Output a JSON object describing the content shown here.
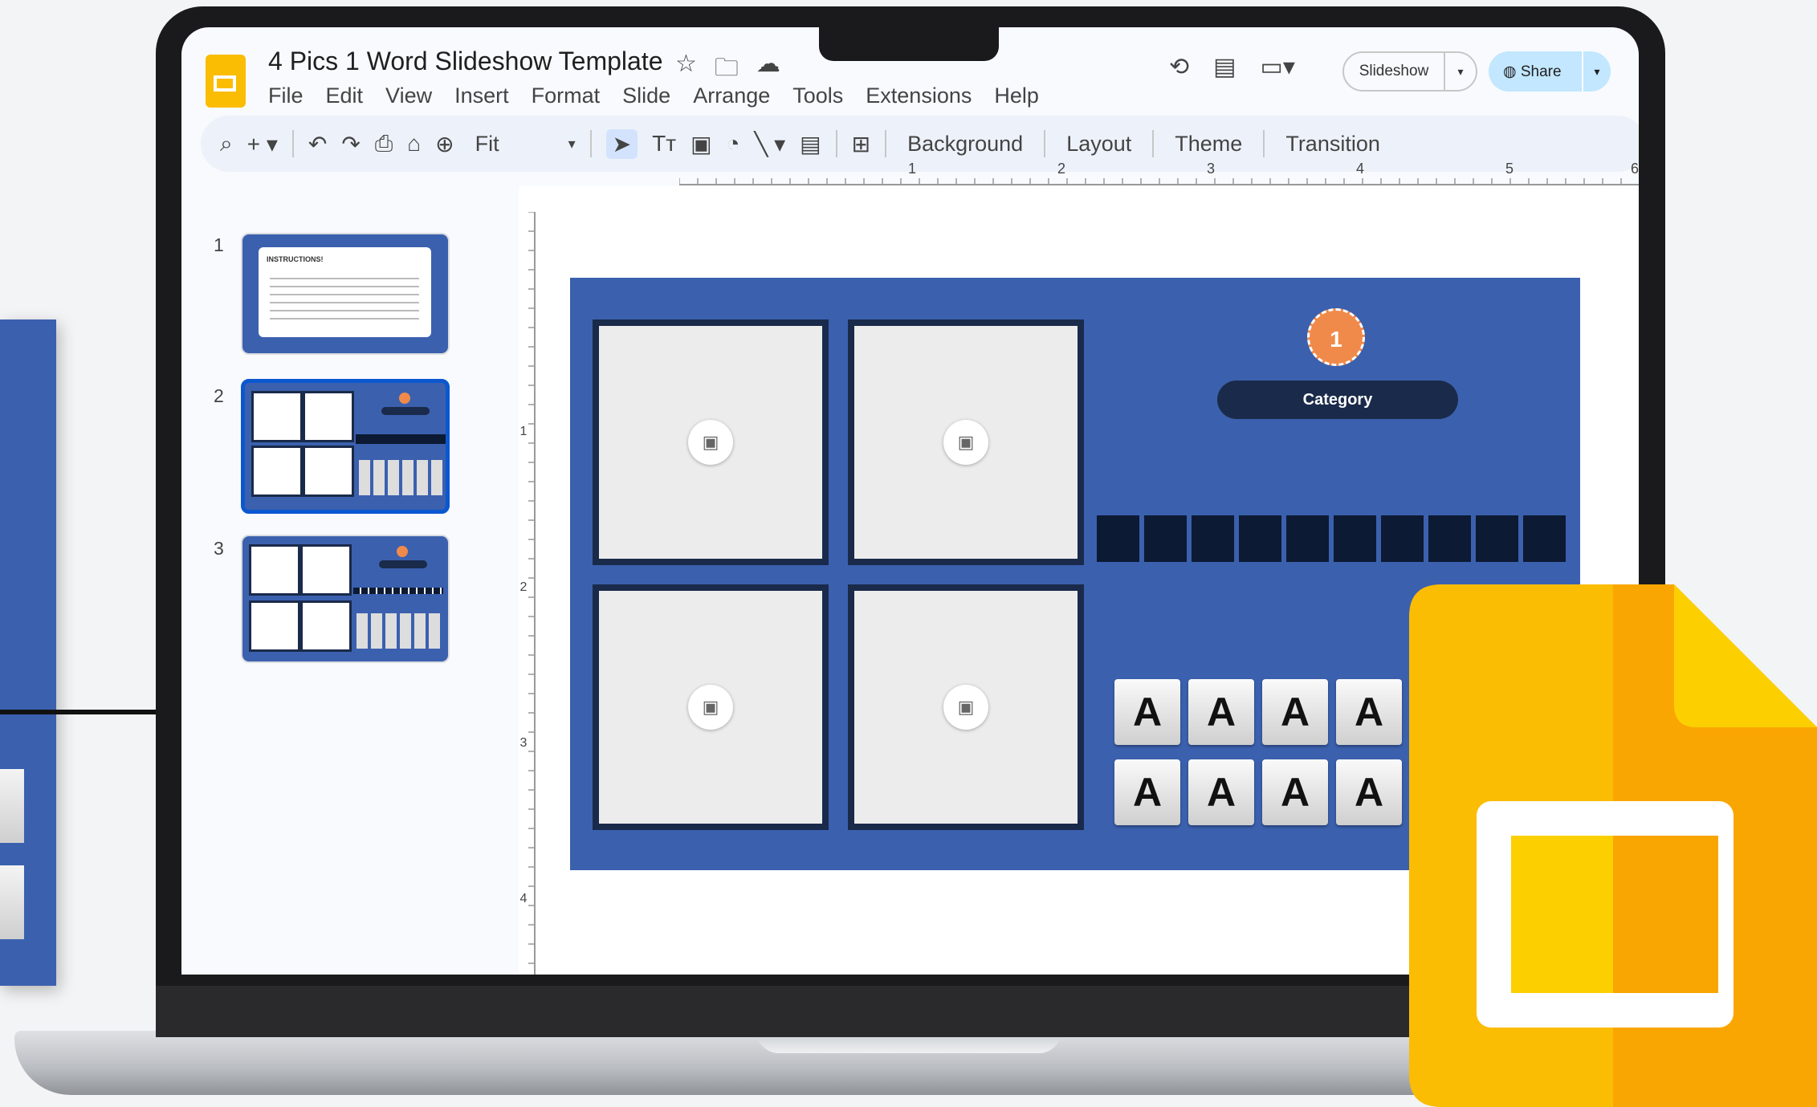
{
  "document": {
    "title": "4 Pics 1 Word Slideshow Template"
  },
  "menu": [
    "File",
    "Edit",
    "View",
    "Insert",
    "Format",
    "Slide",
    "Arrange",
    "Tools",
    "Extensions",
    "Help"
  ],
  "header_buttons": {
    "slideshow": "Slideshow",
    "share": "Share"
  },
  "toolbar": {
    "zoom": "Fit",
    "background": "Background",
    "layout": "Layout",
    "theme": "Theme",
    "transition": "Transition"
  },
  "ruler": {
    "top": [
      "1",
      "2",
      "3",
      "4",
      "5",
      "6"
    ],
    "left": [
      "1",
      "2",
      "3",
      "4"
    ]
  },
  "filmstrip": {
    "slides": [
      "1",
      "2",
      "3"
    ],
    "thumb1_heading": "INSTRUCTIONS!",
    "selected": "2"
  },
  "slide": {
    "badge_number": "1",
    "category_label": "Category",
    "letters_row1": [
      "A",
      "A",
      "A",
      "A"
    ],
    "letters_row2": [
      "A",
      "A",
      "A",
      "A"
    ],
    "answer_box_count": 10
  },
  "colors": {
    "slide_bg": "#3b60ae",
    "dark_navy": "#1a2a4a",
    "badge_orange": "#f08a4b",
    "slides_yellow": "#fbbc04",
    "share_blue": "#c2e7ff"
  },
  "icons": [
    "slides-app-icon",
    "star-icon",
    "folder-move-icon",
    "cloud-icon",
    "history-icon",
    "comment-icon",
    "video-call-icon",
    "globe-icon",
    "search-icon",
    "plus-icon",
    "undo-icon",
    "redo-icon",
    "print-icon",
    "paint-format-icon",
    "zoom-icon",
    "select-icon",
    "text-box-icon",
    "image-icon",
    "shape-icon",
    "line-icon",
    "video-icon",
    "add-comment-icon",
    "image-placeholder-icon"
  ]
}
